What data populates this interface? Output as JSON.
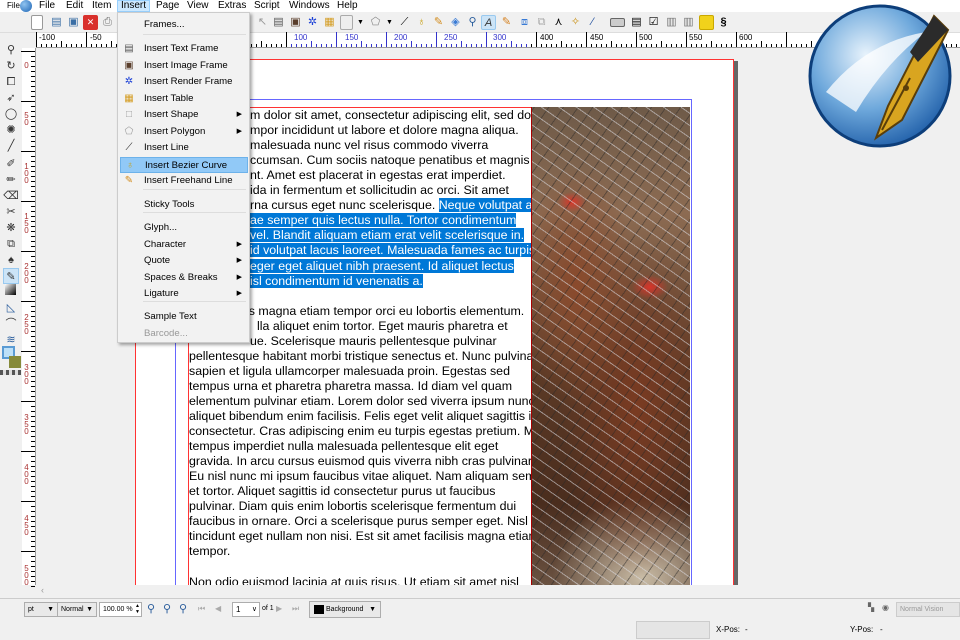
{
  "menubar": {
    "file_small": "File",
    "items": [
      "File",
      "Edit",
      "Item",
      "Insert",
      "Page",
      "View",
      "Extras",
      "Script",
      "Windows",
      "Help"
    ],
    "active": "Insert"
  },
  "insert_menu": {
    "items": [
      {
        "label": "Frames...",
        "icon": "",
        "submenu": false
      },
      {
        "label": "Insert Text Frame",
        "icon": "text-frame-icon",
        "submenu": false
      },
      {
        "label": "Insert Image Frame",
        "icon": "image-frame-icon",
        "submenu": false
      },
      {
        "label": "Insert Render Frame",
        "icon": "render-frame-icon",
        "submenu": false
      },
      {
        "label": "Insert Table",
        "icon": "table-icon",
        "submenu": false
      },
      {
        "label": "Insert Shape",
        "icon": "shape-icon",
        "submenu": true
      },
      {
        "label": "Insert Polygon",
        "icon": "polygon-icon",
        "submenu": true
      },
      {
        "label": "Insert Line",
        "icon": "line-icon",
        "submenu": false
      },
      {
        "label": "Insert Bezier Curve",
        "icon": "bezier-icon",
        "submenu": false,
        "highlighted": true
      },
      {
        "label": "Insert Freehand Line",
        "icon": "pencil-icon",
        "submenu": false
      },
      {
        "label": "Sticky Tools",
        "icon": "",
        "submenu": false
      },
      {
        "label": "Glyph...",
        "icon": "",
        "submenu": false
      },
      {
        "label": "Character",
        "icon": "",
        "submenu": true
      },
      {
        "label": "Quote",
        "icon": "",
        "submenu": true
      },
      {
        "label": "Spaces & Breaks",
        "icon": "",
        "submenu": true
      },
      {
        "label": "Ligature",
        "icon": "",
        "submenu": true
      },
      {
        "label": "Sample Text",
        "icon": "",
        "submenu": false
      },
      {
        "label": "Barcode...",
        "icon": "",
        "submenu": false,
        "disabled": true
      }
    ]
  },
  "rulers": {
    "horizontal": [
      "-100",
      "-50",
      "100",
      "150",
      "200",
      "250",
      "300",
      "400",
      "450",
      "500",
      "550",
      "600"
    ],
    "vertical": [
      "0",
      "50",
      "100",
      "150",
      "200",
      "250",
      "300",
      "350",
      "400",
      "450",
      "500"
    ]
  },
  "document": {
    "para1": [
      {
        "text": "m dolor sit amet, consectetur adipiscing elit, sed do"
      },
      {
        "text": "mpor incididunt ut labore et dolore magna aliqua."
      },
      {
        "text": "malesuada nunc vel risus commodo viverra"
      },
      {
        "text": "ccumsan. Cum sociis natoque penatibus et magnis"
      },
      {
        "text": "nt. Amet est placerat in egestas erat imperdiet."
      },
      {
        "text": "ida in fermentum et sollicitudin ac orci. Sit amet"
      },
      {
        "text": "rna cursus eget nunc scelerisque. ",
        "selected": "Neque volutpat ac"
      },
      {
        "text": "",
        "selected": "ae semper quis lectus nulla. Tortor condimentum"
      },
      {
        "text": "",
        "selected": "vel. Blandit aliquam etiam erat velit scelerisque in."
      },
      {
        "text": "",
        "selected": "id volutpat lacus laoreet. Malesuada fames ac turpis"
      },
      {
        "text": "",
        "selected": "eger eget aliquet nibh praesent. Id aliquet lectus"
      },
      {
        "text": "",
        "selected": "isl condimentum id venenatis a."
      }
    ],
    "para2_partial": [
      "is magna etiam tempor orci eu lobortis elementum.",
      "lla aliquet enim tortor. Eget mauris pharetra et",
      "ue. Scelerisque mauris pellentesque pulvinar"
    ],
    "para2": [
      "pellentesque habitant morbi tristique senectus et. Nunc pulvinar",
      "sapien et ligula ullamcorper malesuada proin. Egestas sed",
      "tempus urna et pharetra pharetra massa. Id diam vel quam",
      "elementum pulvinar etiam. Lorem dolor sed viverra ipsum nunc",
      "aliquet bibendum enim facilisis. Felis eget velit aliquet sagittis id",
      "consectetur. Cras adipiscing enim eu turpis egestas pretium. Mi",
      "tempus imperdiet nulla malesuada pellentesque elit eget",
      "gravida. In arcu cursus euismod quis viverra nibh cras pulvinar.",
      "Eu nisl nunc mi ipsum faucibus vitae aliquet. Nam aliquam sem",
      "et tortor. Aliquet sagittis id consectetur purus ut faucibus",
      "pulvinar. Diam quis enim lobortis scelerisque fermentum dui",
      "faucibus in ornare. Orci a scelerisque purus semper eget. Nisl",
      "tincidunt eget nullam non nisi. Est sit amet facilisis magna etiam",
      "tempor."
    ],
    "para3": [
      "Non odio euismod lacinia at quis risus. Ut etiam sit amet nisl"
    ]
  },
  "statusbar": {
    "unit": "pt",
    "mode": "Normal",
    "zoom": "100.00 %",
    "page": "1",
    "of_pages": "of 1",
    "layer": "Background",
    "vision": "Normal Vision",
    "xpos_label": "X-Pos:",
    "xpos_value": "-",
    "ypos_label": "Y-Pos:",
    "ypos_value": "-"
  },
  "colors": {
    "selection": "#0078d7",
    "menu_highlight": "#91c9f7",
    "margin": "#ff3333",
    "guide": "#6666ff"
  }
}
